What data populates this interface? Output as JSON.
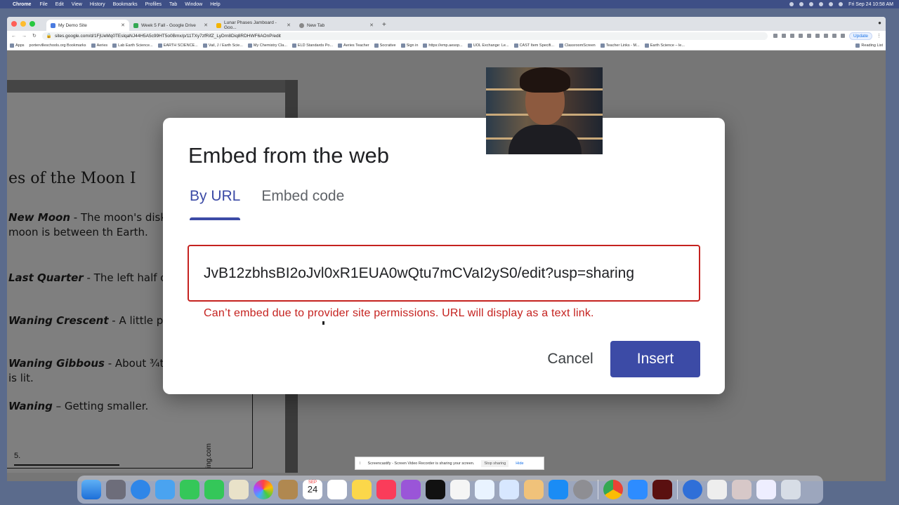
{
  "menubar": {
    "app": "Chrome",
    "items": [
      "File",
      "Edit",
      "View",
      "History",
      "Bookmarks",
      "Profiles",
      "Tab",
      "Window",
      "Help"
    ],
    "clock": "Fri Sep 24  10:58 AM"
  },
  "browser": {
    "tabs": [
      {
        "label": "My Demo Site",
        "active": true
      },
      {
        "label": "Week 5 Fall - Google Drive",
        "active": false
      },
      {
        "label": "Lunar Phases Jamboard - Goo...",
        "active": false
      },
      {
        "label": "New Tab",
        "active": false
      }
    ],
    "url": "sites.google.com/d/1FjUeMq0TEslqaNJ44H5A5c99HT5o0Bmx/p/11TXy7zfRifZ_LyDrn8Diq8RDHWF6AOnP/edit",
    "update_label": "Update",
    "bookmarks": [
      "Apps",
      "portervilleschools.org Bookmarks",
      "Aeries",
      "Lab Earth Science...",
      "EARTH SCIENCE...",
      "Vail, J / Earth Scie...",
      "My Chemistry Cla...",
      "ELD Standards Po...",
      "Aeries Teacher",
      "Socrative",
      "Sign in",
      "https://emp.aesop...",
      "UOL Exchange: Le...",
      "CAST Item Specifi...",
      "ClassroomScreen",
      "Teacher Links - M...",
      "Earth Science – le..."
    ],
    "reading_list": "Reading List"
  },
  "document": {
    "heading": "es of the Moon I",
    "paragraphs": [
      {
        "term": "New Moon",
        "text": " - The moon's disk fo because the moon is between th Earth."
      },
      {
        "term": "Last Quarter",
        "text": " - The left half o disk is lit."
      },
      {
        "term": "Waning Crescent",
        "text": " - A little par left side is lit."
      },
      {
        "term": "Waning Gibbous",
        "text": " - About ¾th of moon's disk is lit."
      },
      {
        "term": "Waning",
        "text": " – Getting smaller."
      }
    ],
    "number": "5.",
    "side_text": "ing.com"
  },
  "modal": {
    "title": "Embed from the web",
    "tabs": [
      {
        "label": "By URL",
        "active": true
      },
      {
        "label": "Embed code",
        "active": false
      }
    ],
    "url_value": "JvB12zbhsBI2oJvl0xR1EUA0wQtu7mCVaI2yS0/edit?usp=sharing",
    "error": "Can’t embed due to provider site permissions. URL will display as a text link.",
    "cancel_label": "Cancel",
    "insert_label": "Insert"
  },
  "castbar": {
    "message": "Screencastify - Screen Video Recorder is sharing your screen.",
    "stop_label": "Stop sharing",
    "hide_label": "Hide"
  },
  "dock": {
    "date_month": "SEP",
    "date_day": "24"
  },
  "colors": {
    "accent": "#3c4ba6",
    "error": "#c5221f"
  }
}
